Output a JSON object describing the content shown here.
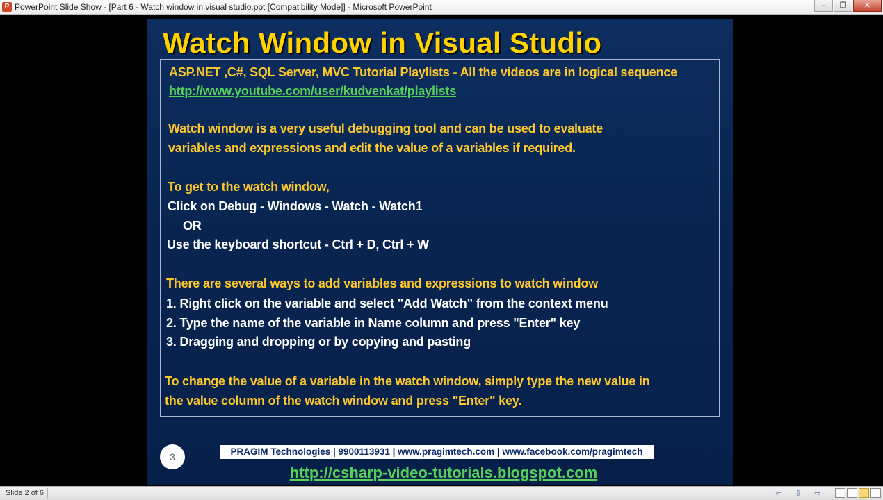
{
  "window": {
    "app_icon_label": "P",
    "title": "PowerPoint Slide Show - [Part 6 - Watch window in visual studio.ppt [Compatibility Mode]] - Microsoft PowerPoint",
    "minimize_glyph": "–",
    "restore_glyph": "❐",
    "close_glyph": "✕"
  },
  "slide": {
    "title": "Watch Window in Visual Studio",
    "lines": {
      "playlist_text": "ASP.NET ,C#, SQL Server, MVC Tutorial Playlists - All the videos are in logical sequence",
      "playlist_url": "http://www.youtube.com/user/kudvenkat/playlists",
      "desc1": "Watch window is a very useful debugging tool and can be used to evaluate",
      "desc2": "variables and expressions and edit the value of a variables if required.",
      "get_to": "To get to the watch window,",
      "click_on": "Click on Debug - Windows - Watch - Watch1",
      "or": "OR",
      "shortcut": "Use the keyboard shortcut - Ctrl + D, Ctrl + W",
      "ways_header": "There are several ways to add variables and expressions to watch window",
      "way1": "1. Right click on the variable and select \"Add Watch\" from the context menu",
      "way2": "2. Type the name of the variable in Name column and press \"Enter\" key",
      "way3": "3. Dragging and dropping or by copying and pasting",
      "change1": "To change the value of a variable in the watch window, simply type the new value in",
      "change2": "the value column of the watch window and press \"Enter\" key."
    },
    "slide_number": "3",
    "footer": "PRAGIM Technologies | 9900113931 | www.pragimtech.com | www.facebook.com/pragimtech",
    "blog_url": "http://csharp-video-tutorials.blogspot.com"
  },
  "statusbar": {
    "slide_info": "Slide 2 of 6",
    "prev_glyph": "⇦",
    "menu_glyph": "⇩",
    "next_glyph": "⇨"
  }
}
